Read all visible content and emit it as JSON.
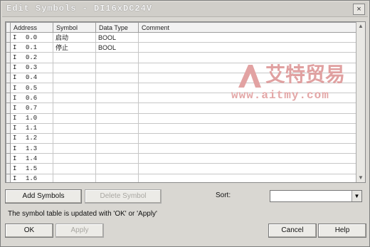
{
  "window": {
    "title": "Edit Symbols - DI16xDC24V",
    "close_glyph": "×"
  },
  "table": {
    "headers": [
      "Address",
      "Symbol",
      "Data Type",
      "Comment"
    ],
    "rows": [
      {
        "type": "I",
        "addr": "0.0",
        "symbol": "启动",
        "datatype": "BOOL",
        "comment": ""
      },
      {
        "type": "I",
        "addr": "0.1",
        "symbol": "停止",
        "datatype": "BOOL",
        "comment": ""
      },
      {
        "type": "I",
        "addr": "0.2",
        "symbol": "",
        "datatype": "",
        "comment": ""
      },
      {
        "type": "I",
        "addr": "0.3",
        "symbol": "",
        "datatype": "",
        "comment": ""
      },
      {
        "type": "I",
        "addr": "0.4",
        "symbol": "",
        "datatype": "",
        "comment": ""
      },
      {
        "type": "I",
        "addr": "0.5",
        "symbol": "",
        "datatype": "",
        "comment": ""
      },
      {
        "type": "I",
        "addr": "0.6",
        "symbol": "",
        "datatype": "",
        "comment": ""
      },
      {
        "type": "I",
        "addr": "0.7",
        "symbol": "",
        "datatype": "",
        "comment": ""
      },
      {
        "type": "I",
        "addr": "1.0",
        "symbol": "",
        "datatype": "",
        "comment": ""
      },
      {
        "type": "I",
        "addr": "1.1",
        "symbol": "",
        "datatype": "",
        "comment": ""
      },
      {
        "type": "I",
        "addr": "1.2",
        "symbol": "",
        "datatype": "",
        "comment": ""
      },
      {
        "type": "I",
        "addr": "1.3",
        "symbol": "",
        "datatype": "",
        "comment": ""
      },
      {
        "type": "I",
        "addr": "1.4",
        "symbol": "",
        "datatype": "",
        "comment": ""
      },
      {
        "type": "I",
        "addr": "1.5",
        "symbol": "",
        "datatype": "",
        "comment": ""
      },
      {
        "type": "I",
        "addr": "1.6",
        "symbol": "",
        "datatype": "",
        "comment": ""
      }
    ]
  },
  "buttons": {
    "add_symbols": "Add Symbols",
    "delete_symbol": "Delete Symbol",
    "ok": "OK",
    "apply": "Apply",
    "cancel": "Cancel",
    "help": "Help"
  },
  "sort": {
    "label": "Sort:",
    "value": ""
  },
  "status_text": "The symbol table is updated with 'OK' or 'Apply'",
  "watermark": {
    "text": "艾特贸易",
    "url": "www.aitmy.com"
  },
  "icons": {
    "close": "close-icon",
    "scroll_up": "chevron-up-icon",
    "scroll_down": "chevron-down-icon",
    "dropdown": "chevron-down-icon"
  },
  "colors": {
    "dialog_bg": "#d9d7d2",
    "grid_bg": "#ffffff",
    "watermark": "#e0a0a0"
  }
}
